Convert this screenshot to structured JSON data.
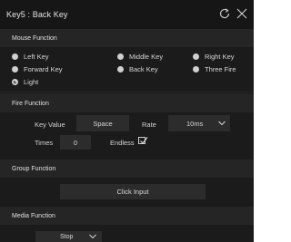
{
  "window": {
    "title": "Key5 : Back Key"
  },
  "icons": {
    "refresh": "refresh-icon",
    "close": "close-icon",
    "chevron": "chevron-down-icon",
    "check": "checkmark-icon"
  },
  "mouse_function": {
    "header": "Mouse Function",
    "options": [
      "Left Key",
      "Middle Key",
      "Right Key",
      "Forward Key",
      "Back Key",
      "Three Fire",
      "Light"
    ],
    "selected": "Light"
  },
  "fire_function": {
    "header": "Fire Function",
    "key_value_label": "Key Value",
    "key_value": "Space",
    "rate_label": "Rate",
    "rate_value": "10ms",
    "times_label": "Times",
    "times_value": "0",
    "endless_label": "Endless",
    "endless_checked": true
  },
  "group_function": {
    "header": "Group Function",
    "input_button": "Click Input"
  },
  "media_function": {
    "header": "Media Function",
    "value": "Stop"
  },
  "colors": {
    "background": "#1f1f1f",
    "panel": "#1b1b1b",
    "header": "#252525",
    "field": "#2c2c2c",
    "text": "#d8d8d8"
  }
}
